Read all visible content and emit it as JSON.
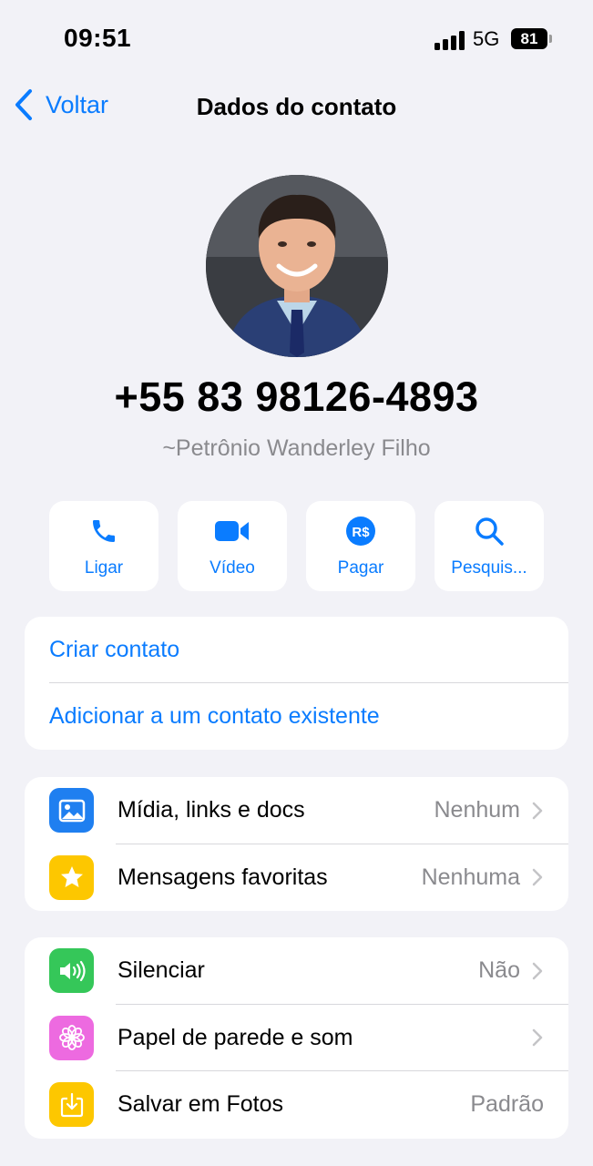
{
  "status_bar": {
    "time": "09:51",
    "network": "5G",
    "battery": "81"
  },
  "nav": {
    "back_label": "Voltar",
    "title": "Dados do contato"
  },
  "contact": {
    "phone": "+55 83 98126-4893",
    "push_name": "~Petrônio Wanderley Filho"
  },
  "actions": [
    {
      "label": "Ligar",
      "icon": "phone-icon"
    },
    {
      "label": "Vídeo",
      "icon": "video-camera-icon"
    },
    {
      "label": "Pagar",
      "icon": "real-currency-icon"
    },
    {
      "label": "Pesquis...",
      "icon": "search-icon"
    }
  ],
  "contact_links": {
    "create": "Criar contato",
    "add_existing": "Adicionar a um contato existente"
  },
  "media_section": [
    {
      "label": "Mídia, links e docs",
      "value": "Nenhum",
      "icon": "photo-icon",
      "color": "#1f7ff0"
    },
    {
      "label": "Mensagens favoritas",
      "value": "Nenhuma",
      "icon": "star-icon",
      "color": "#fdc700"
    }
  ],
  "settings_section": [
    {
      "label": "Silenciar",
      "value": "Não",
      "icon": "speaker-icon",
      "color": "#35c759"
    },
    {
      "label": "Papel de parede e som",
      "value": "",
      "icon": "flower-icon",
      "color": "#ed6ae0"
    },
    {
      "label": "Salvar em Fotos",
      "value": "Padrão",
      "icon": "save-download-icon",
      "color": "#fdc700"
    }
  ],
  "colors": {
    "accent": "#0a7cff",
    "background": "#f2f2f7",
    "secondary_text": "#8a8a8e"
  }
}
